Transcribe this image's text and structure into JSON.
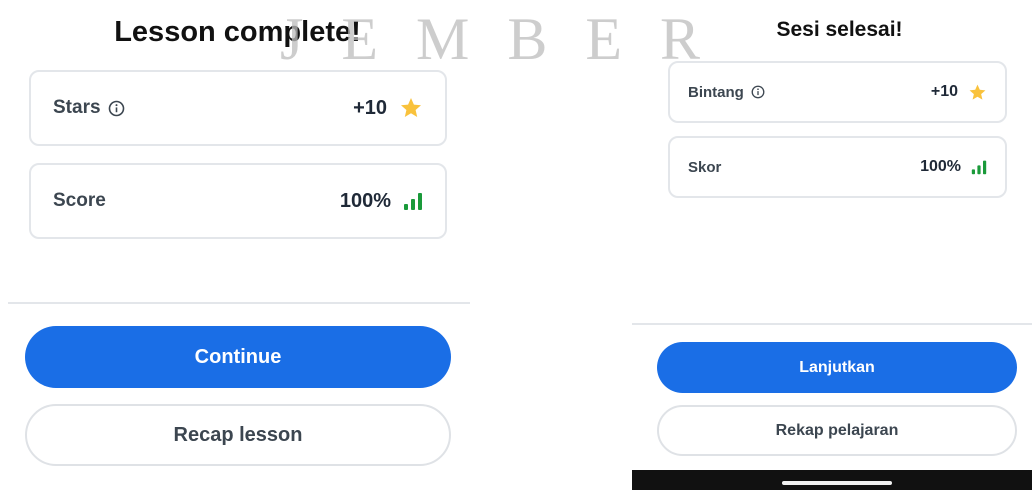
{
  "watermark": {
    "text": "JEMBER"
  },
  "left_screen": {
    "title": "Lesson complete!",
    "stars": {
      "label": "Stars",
      "value": "+10",
      "info_icon": "info-icon",
      "icon": "star-icon"
    },
    "score": {
      "label": "Score",
      "value": "100%",
      "icon": "signal-bars-icon"
    },
    "continue_label": "Continue",
    "recap_label": "Recap lesson"
  },
  "right_screen": {
    "title": "Sesi selesai!",
    "stars": {
      "label": "Bintang",
      "value": "+10",
      "info_icon": "info-icon",
      "icon": "star-icon"
    },
    "score": {
      "label": "Skor",
      "value": "100%",
      "icon": "signal-bars-icon"
    },
    "continue_label": "Lanjutkan",
    "recap_label": "Rekap pelajaran"
  },
  "colors": {
    "primary_button": "#1a6ee6",
    "star": "#f9c23c",
    "score_bars": "#1a9a3a",
    "card_border": "#e3e6ea"
  }
}
